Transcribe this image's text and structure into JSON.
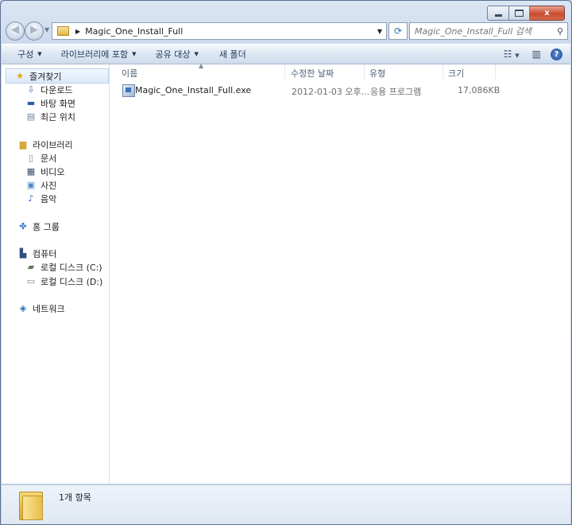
{
  "window": {
    "caption": {
      "minimize": "",
      "maximize": "",
      "close": "x"
    }
  },
  "address": {
    "path": "Magic_One_Install_Full",
    "search_placeholder": "Magic_One_Install_Full 검색"
  },
  "commands": {
    "organize": "구성",
    "include_library": "라이브러리에 포함",
    "share_with": "공유 대상",
    "new_folder": "새 폴더"
  },
  "nav": {
    "favorites": "즐겨찾기",
    "downloads": "다운로드",
    "desktop": "바탕 화면",
    "recent": "최근 위치",
    "libraries": "라이브러리",
    "documents": "문서",
    "videos": "비디오",
    "pictures": "사진",
    "music": "음악",
    "homegroup": "홈 그룹",
    "computer": "컴퓨터",
    "disk_c": "로컬 디스크 (C:)",
    "disk_d": "로컬 디스크 (D:)",
    "network": "네트워크"
  },
  "columns": {
    "name": "이름",
    "modified": "수정한 날짜",
    "type": "유형",
    "size": "크기"
  },
  "files": [
    {
      "name": "Magic_One_Install_Full.exe",
      "modified": "2012-01-03 오후...",
      "type": "응용 프로그램",
      "size": "17,086KB"
    }
  ],
  "status": {
    "item_count": "1개 항목"
  },
  "icons": {
    "back": "back-arrow-icon",
    "forward": "forward-arrow-icon",
    "refresh": "refresh-icon",
    "search": "search-icon",
    "help": "help-icon"
  }
}
